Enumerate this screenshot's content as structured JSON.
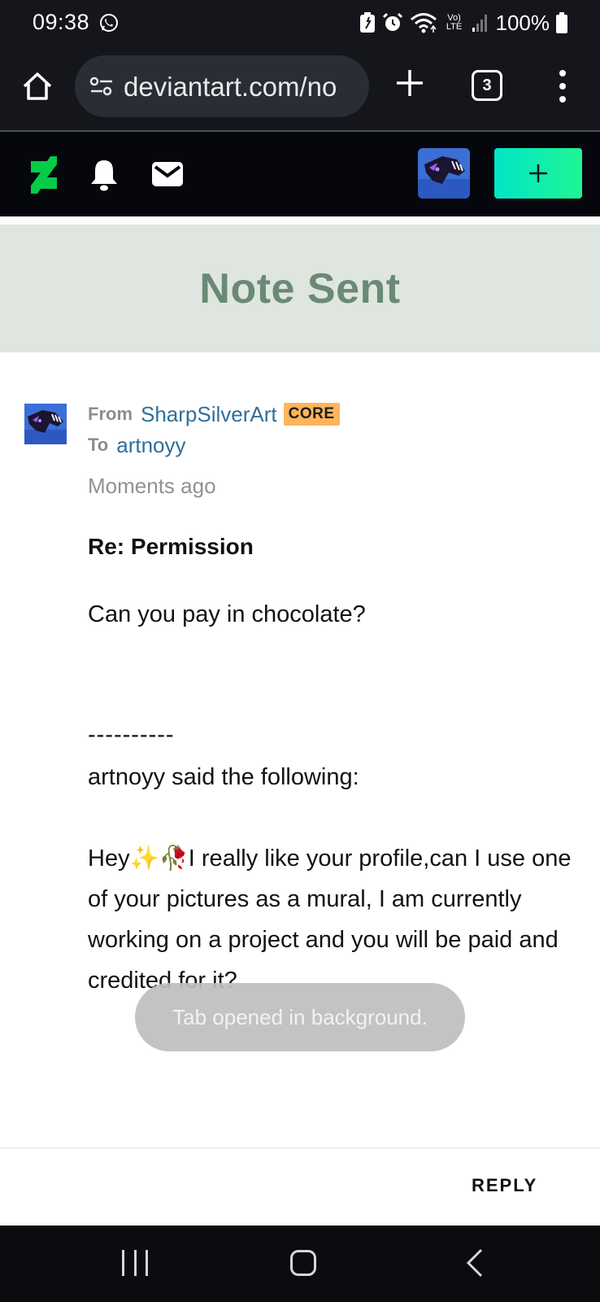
{
  "status_bar": {
    "time": "09:38",
    "battery": "100%",
    "icons": [
      "whatsapp-icon",
      "battery-saver-icon",
      "alarm-icon",
      "wifi-icon",
      "volte-icon",
      "signal-icon",
      "battery-icon"
    ],
    "volte_label": "Vo) LTE"
  },
  "browser": {
    "url": "deviantart.com/no",
    "tab_count": "3"
  },
  "header": {
    "create_label": "+"
  },
  "banner": {
    "title": "Note Sent"
  },
  "note": {
    "from_label": "From",
    "from_user": "SharpSilverArt",
    "badge": "CORE",
    "to_label": "To",
    "to_user": "artnoyy",
    "time": "Moments ago",
    "subject": "Re: Permission",
    "body": "Can you pay in chocolate?",
    "separator": "----------",
    "quote_intro": "artnoyy said the following:",
    "quote_body": "Hey✨🥀I really like your profile,can I use one of your pictures as a mural, I am currently working on a project and you will be paid and credited for it?"
  },
  "toast": {
    "text": "Tab opened in background."
  },
  "footer": {
    "reply_label": "REPLY"
  },
  "colors": {
    "banner_bg": "#dfe6df",
    "banner_text": "#6a8a75",
    "link": "#2f6f9b",
    "core_badge": "#ffb55a",
    "da_green": "#05cc47",
    "create_gradient_start": "#00e6c8",
    "create_gradient_end": "#1ff594"
  }
}
